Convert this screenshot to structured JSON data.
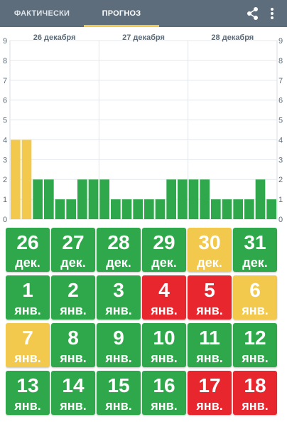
{
  "tabs": {
    "facts_label": "ФАКТИЧЕСКИ",
    "forecast_label": "ПРОГНОЗ"
  },
  "actions": {
    "share_icon": "share-icon",
    "menu_icon": "more-vert-icon"
  },
  "colors": {
    "green": "#2ea84a",
    "yellow": "#f2c94c",
    "red": "#e8262d",
    "header": "#5d6d7b"
  },
  "chart_data": {
    "type": "bar",
    "ylim": [
      0,
      9
    ],
    "yticks": [
      "0",
      "1",
      "2",
      "3",
      "4",
      "5",
      "6",
      "7",
      "8",
      "9"
    ],
    "day_labels": [
      "26 декабря",
      "27 декабря",
      "28 декабря"
    ],
    "values": [
      4,
      4,
      2,
      2,
      1,
      1,
      2,
      2,
      2,
      1,
      1,
      1,
      1,
      1,
      2,
      2,
      2,
      2,
      1,
      1,
      1,
      1,
      2,
      1
    ],
    "colors": [
      "yellow",
      "yellow",
      "green",
      "green",
      "green",
      "green",
      "green",
      "green",
      "green",
      "green",
      "green",
      "green",
      "green",
      "green",
      "green",
      "green",
      "green",
      "green",
      "green",
      "green",
      "green",
      "green",
      "green",
      "green"
    ],
    "grid": true
  },
  "days": [
    {
      "num": "26",
      "mon": "дек.",
      "color": "green"
    },
    {
      "num": "27",
      "mon": "дек.",
      "color": "green"
    },
    {
      "num": "28",
      "mon": "дек.",
      "color": "green"
    },
    {
      "num": "29",
      "mon": "дек.",
      "color": "green"
    },
    {
      "num": "30",
      "mon": "дек.",
      "color": "yellow"
    },
    {
      "num": "31",
      "mon": "дек.",
      "color": "green"
    },
    {
      "num": "1",
      "mon": "янв.",
      "color": "green"
    },
    {
      "num": "2",
      "mon": "янв.",
      "color": "green"
    },
    {
      "num": "3",
      "mon": "янв.",
      "color": "green"
    },
    {
      "num": "4",
      "mon": "янв.",
      "color": "red"
    },
    {
      "num": "5",
      "mon": "янв.",
      "color": "red"
    },
    {
      "num": "6",
      "mon": "янв.",
      "color": "yellow"
    },
    {
      "num": "7",
      "mon": "янв.",
      "color": "yellow"
    },
    {
      "num": "8",
      "mon": "янв.",
      "color": "green"
    },
    {
      "num": "9",
      "mon": "янв.",
      "color": "green"
    },
    {
      "num": "10",
      "mon": "янв.",
      "color": "green"
    },
    {
      "num": "11",
      "mon": "янв.",
      "color": "green"
    },
    {
      "num": "12",
      "mon": "янв.",
      "color": "green"
    },
    {
      "num": "13",
      "mon": "янв.",
      "color": "green"
    },
    {
      "num": "14",
      "mon": "янв.",
      "color": "green"
    },
    {
      "num": "15",
      "mon": "янв.",
      "color": "green"
    },
    {
      "num": "16",
      "mon": "янв.",
      "color": "green"
    },
    {
      "num": "17",
      "mon": "янв.",
      "color": "red"
    },
    {
      "num": "18",
      "mon": "янв.",
      "color": "red"
    }
  ]
}
